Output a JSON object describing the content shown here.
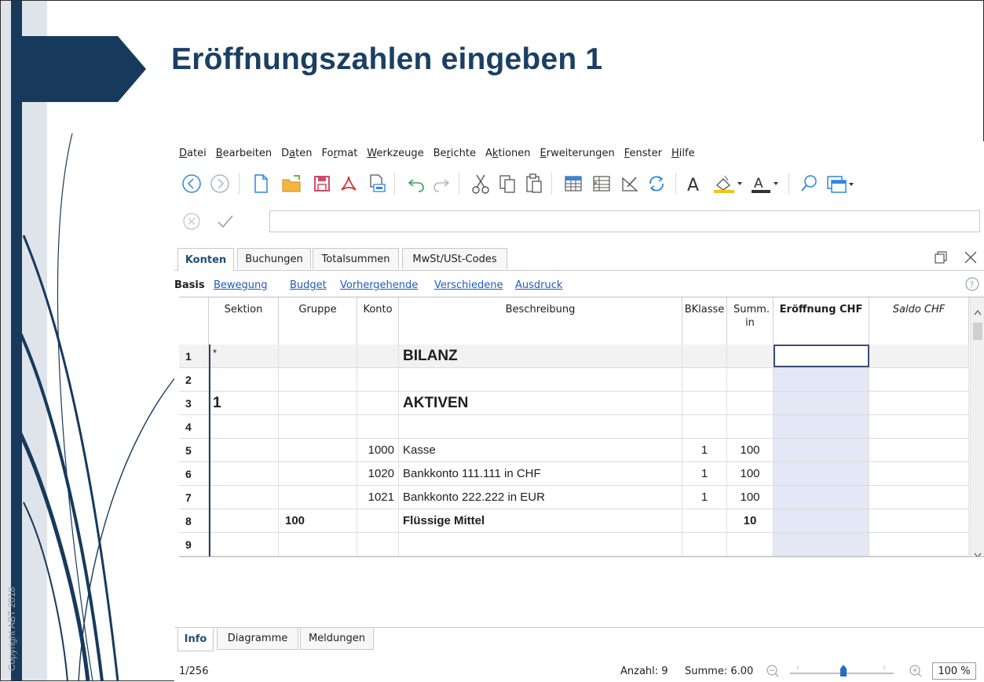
{
  "slide": {
    "title": "Eröffnungszahlen eingeben 1",
    "copyright": "Copyright ABT 2018"
  },
  "menu": [
    {
      "pre": "",
      "ul": "D",
      "post": "atei"
    },
    {
      "pre": "",
      "ul": "B",
      "post": "earbeiten"
    },
    {
      "pre": "D",
      "ul": "a",
      "post": "ten"
    },
    {
      "pre": "Fo",
      "ul": "r",
      "post": "mat"
    },
    {
      "pre": "",
      "ul": "W",
      "post": "erkzeuge"
    },
    {
      "pre": "Be",
      "ul": "r",
      "post": "ichte"
    },
    {
      "pre": "A",
      "ul": "k",
      "post": "tionen"
    },
    {
      "pre": "",
      "ul": "E",
      "post": "rweiterungen"
    },
    {
      "pre": "",
      "ul": "F",
      "post": "enster"
    },
    {
      "pre": "",
      "ul": "H",
      "post": "ilfe"
    }
  ],
  "toolbar_icons": [
    "back-icon",
    "forward-icon",
    "new-file-icon",
    "open-folder-icon",
    "save-icon",
    "pdf-icon",
    "print-preview-icon",
    "undo-icon",
    "redo-icon",
    "cut-icon",
    "copy-icon",
    "paste-icon",
    "insert-row-icon",
    "add-rows-icon",
    "edit-icon",
    "recalculate-icon",
    "font-icon",
    "fill-color-icon",
    "text-color-icon",
    "search-icon",
    "window-icon"
  ],
  "tabs": [
    "Konten",
    "Buchungen",
    "Totalsummen",
    "MwSt/USt-Codes"
  ],
  "active_tab": "Konten",
  "views": [
    "Basis",
    "Bewegung",
    "Budget",
    "Vorhergehende",
    "Verschiedene",
    "Ausdruck"
  ],
  "active_view": "Basis",
  "columns": [
    "Sektion",
    "Gruppe",
    "Konto",
    "Beschreibung",
    "BKlasse",
    "Summ. in",
    "Eröffnung CHF",
    "Saldo CHF"
  ],
  "rows": [
    {
      "n": "1",
      "sektion": "*",
      "gruppe": "",
      "konto": "",
      "beschreibung": "BILANZ",
      "bklasse": "",
      "summ": "",
      "eroeffnung": "",
      "saldo": ""
    },
    {
      "n": "2",
      "sektion": "",
      "gruppe": "",
      "konto": "",
      "beschreibung": "",
      "bklasse": "",
      "summ": "",
      "eroeffnung": "",
      "saldo": ""
    },
    {
      "n": "3",
      "sektion": "1",
      "gruppe": "",
      "konto": "",
      "beschreibung": "AKTIVEN",
      "bklasse": "",
      "summ": "",
      "eroeffnung": "",
      "saldo": ""
    },
    {
      "n": "4",
      "sektion": "",
      "gruppe": "",
      "konto": "",
      "beschreibung": "",
      "bklasse": "",
      "summ": "",
      "eroeffnung": "",
      "saldo": ""
    },
    {
      "n": "5",
      "sektion": "",
      "gruppe": "",
      "konto": "1000",
      "beschreibung": "Kasse",
      "bklasse": "1",
      "summ": "100",
      "eroeffnung": "",
      "saldo": ""
    },
    {
      "n": "6",
      "sektion": "",
      "gruppe": "",
      "konto": "1020",
      "beschreibung": "Bankkonto 111.111 in CHF",
      "bklasse": "1",
      "summ": "100",
      "eroeffnung": "",
      "saldo": ""
    },
    {
      "n": "7",
      "sektion": "",
      "gruppe": "",
      "konto": "1021",
      "beschreibung": "Bankkonto 222.222 in EUR",
      "bklasse": "1",
      "summ": "100",
      "eroeffnung": "",
      "saldo": ""
    },
    {
      "n": "8",
      "sektion": "",
      "gruppe": "100",
      "konto": "",
      "beschreibung": "Flüssige Mittel",
      "bklasse": "",
      "summ": "10",
      "eroeffnung": "",
      "saldo": ""
    },
    {
      "n": "9",
      "sektion": "",
      "gruppe": "",
      "konto": "",
      "beschreibung": "",
      "bklasse": "",
      "summ": "",
      "eroeffnung": "",
      "saldo": ""
    }
  ],
  "bottom_tabs": [
    "Info",
    "Diagramme",
    "Meldungen"
  ],
  "status": {
    "position": "1/256",
    "count": "Anzahl: 9",
    "sum": "Summe: 6.00",
    "zoom": "100 %"
  },
  "colors": {
    "title": "#1b3f63",
    "accent_dark": "#173a5c",
    "selected_column": "#e4e7f5",
    "link": "#1f5bbf"
  }
}
